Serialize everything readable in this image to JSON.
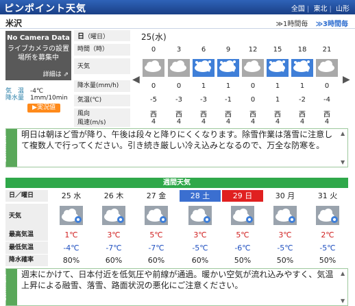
{
  "header": {
    "title": "ピンポイント天気",
    "crumbs": [
      "全国",
      "東北",
      "山形"
    ]
  },
  "city": "米沢",
  "tabs": {
    "hourly1": "1時間毎",
    "hourly3": "3時間毎"
  },
  "camera": {
    "title": "No Camera Data",
    "message": "ライブカメラの設置場所を募集中",
    "detail": "詳細は"
  },
  "station": {
    "temp_label": "気　温",
    "temp": "-4℃",
    "precip_label": "降水量",
    "precip": "1mm/10min",
    "live": "実況値"
  },
  "hourly": {
    "date_label": "日（曜日）",
    "date_value": "25(水)",
    "row_labels": {
      "time": "時間（時）",
      "weather": "天気",
      "precip": "降水量(mm/h)",
      "temp": "気温(℃)",
      "wind_dir": "風向",
      "wind_speed": "風速(m/s)"
    },
    "times": [
      "0",
      "3",
      "6",
      "9",
      "12",
      "15",
      "18",
      "21"
    ],
    "weather_icons": [
      "cloud-icon",
      "cloud-icon",
      "snow-icon",
      "snow-icon",
      "cloud-icon",
      "snow-icon",
      "snow-icon",
      "cloud-icon"
    ],
    "precip": [
      "0",
      "0",
      "1",
      "1",
      "0",
      "1",
      "1",
      "0"
    ],
    "temp": [
      "-5",
      "-3",
      "-3",
      "-1",
      "0",
      "1",
      "-2",
      "-4"
    ],
    "wind_dir": [
      "西",
      "西",
      "西",
      "西",
      "西",
      "西",
      "西",
      "西"
    ],
    "wind_speed": [
      "4",
      "4",
      "4",
      "4",
      "4",
      "4",
      "4",
      "4"
    ]
  },
  "comment1": {
    "label": "Comment",
    "text": "明日は朝ほど雪が降り、午後は段々と降りにくくなります。除雪作業は落雪に注意して複数人で行ってください。引き続き厳しい冷え込みとなるので、万全な防寒を。"
  },
  "weekly": {
    "title": "週間天気",
    "row_labels": {
      "date": "日／曜日",
      "weather": "天気",
      "max": "最高気温",
      "min": "最低気温",
      "pop": "降水確率"
    },
    "days": [
      {
        "date": "25 水",
        "max": "1℃",
        "min": "-4℃",
        "pop": "80%",
        "icon": "snow-cloud-icon",
        "style": "normal"
      },
      {
        "date": "26 木",
        "max": "3℃",
        "min": "-7℃",
        "pop": "60%",
        "icon": "cloud-snow-icon",
        "style": "normal"
      },
      {
        "date": "27 金",
        "max": "5℃",
        "min": "-7℃",
        "pop": "60%",
        "icon": "cloud-snow-icon",
        "style": "normal"
      },
      {
        "date": "28 土",
        "max": "3℃",
        "min": "-5℃",
        "pop": "60%",
        "icon": "cloud-snow-icon",
        "style": "sat"
      },
      {
        "date": "29 日",
        "max": "5℃",
        "min": "-6℃",
        "pop": "50%",
        "icon": "cloud-snow-icon",
        "style": "sun"
      },
      {
        "date": "30 月",
        "max": "3℃",
        "min": "-5℃",
        "pop": "50%",
        "icon": "cloud-snow-icon",
        "style": "normal"
      },
      {
        "date": "31 火",
        "max": "2℃",
        "min": "-5℃",
        "pop": "50%",
        "icon": "cloud-snow-icon",
        "style": "normal"
      }
    ]
  },
  "comment2": {
    "label": "Comment",
    "text": "週末にかけて、日本付近を低気圧や前線が通過。暖かい空気が流れ込みやすく、気温上昇による融雪、落雪、路面状況の悪化にご注意ください。"
  }
}
